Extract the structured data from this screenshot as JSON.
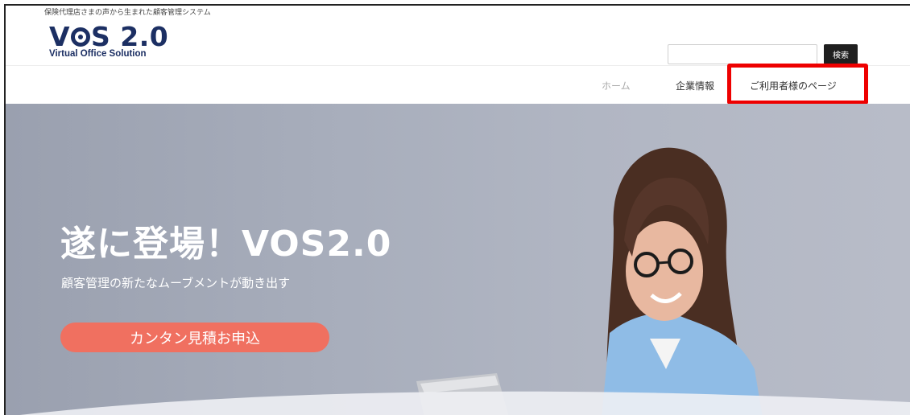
{
  "site": {
    "tagline": "保険代理店さまの声から生まれた顧客管理システム",
    "logo": {
      "prefix": "V",
      "suffix": "S 2.0",
      "subtitle": "Virtual Office Solution"
    }
  },
  "search": {
    "value": "",
    "placeholder": "",
    "button_label": "検索"
  },
  "nav": {
    "items": [
      {
        "label": "ホーム"
      },
      {
        "label": "企業情報"
      },
      {
        "label": "ご利用者様のページ"
      }
    ]
  },
  "hero": {
    "title": "遂に登場！VOS2.0",
    "subtitle": "顧客管理の新たなムーブメントが動き出す",
    "cta_label": "カンタン見積お申込"
  },
  "colors": {
    "brand_navy": "#1c2f63",
    "cta": "#f07060",
    "highlight": "#ee0000",
    "search_button": "#1f1f1f"
  }
}
